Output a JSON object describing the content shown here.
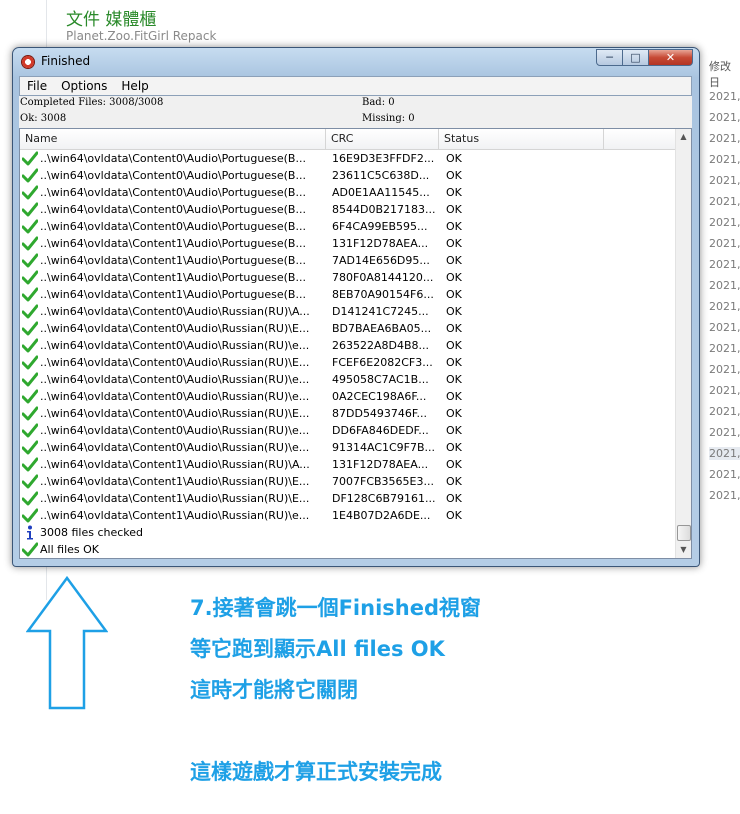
{
  "background": {
    "title": "文件 媒體櫃",
    "subtitle": "Planet.Zoo.FitGirl Repack",
    "column_header": "修改日",
    "dates": [
      "2021,",
      "2021,",
      "2021,",
      "2021,",
      "2021,",
      "2021,",
      "2021,",
      "2021,",
      "2021,",
      "2021,",
      "2021,",
      "2021,",
      "2021,",
      "2021,",
      "2021,",
      "2021,",
      "2021,",
      "2021,",
      "2021,",
      "2021,"
    ]
  },
  "window": {
    "title": "Finished",
    "buttons": {
      "minimize": "─",
      "maximize": "□",
      "close": "✕"
    },
    "menu": [
      "File",
      "Options",
      "Help"
    ],
    "status": {
      "completed": "Completed Files: 3008/3008",
      "bad": "Bad: 0",
      "ok": "Ok: 3008",
      "missing": "Missing: 0"
    },
    "columns": [
      "Name",
      "CRC",
      "Status"
    ],
    "rows": [
      {
        "name": "..\\win64\\ovldata\\Content0\\Audio\\Portuguese(B...",
        "crc": "16E9D3E3FFDF2...",
        "status": "OK"
      },
      {
        "name": "..\\win64\\ovldata\\Content0\\Audio\\Portuguese(B...",
        "crc": "23611C5C638D...",
        "status": "OK"
      },
      {
        "name": "..\\win64\\ovldata\\Content0\\Audio\\Portuguese(B...",
        "crc": "AD0E1AA11545...",
        "status": "OK"
      },
      {
        "name": "..\\win64\\ovldata\\Content0\\Audio\\Portuguese(B...",
        "crc": "8544D0B217183...",
        "status": "OK"
      },
      {
        "name": "..\\win64\\ovldata\\Content0\\Audio\\Portuguese(B...",
        "crc": "6F4CA99EB595...",
        "status": "OK"
      },
      {
        "name": "..\\win64\\ovldata\\Content1\\Audio\\Portuguese(B...",
        "crc": "131F12D78AEA...",
        "status": "OK"
      },
      {
        "name": "..\\win64\\ovldata\\Content1\\Audio\\Portuguese(B...",
        "crc": "7AD14E656D95...",
        "status": "OK"
      },
      {
        "name": "..\\win64\\ovldata\\Content1\\Audio\\Portuguese(B...",
        "crc": "780F0A8144120...",
        "status": "OK"
      },
      {
        "name": "..\\win64\\ovldata\\Content1\\Audio\\Portuguese(B...",
        "crc": "8EB70A90154F6...",
        "status": "OK"
      },
      {
        "name": "..\\win64\\ovldata\\Content0\\Audio\\Russian(RU)\\A...",
        "crc": "D141241C7245...",
        "status": "OK"
      },
      {
        "name": "..\\win64\\ovldata\\Content0\\Audio\\Russian(RU)\\E...",
        "crc": "BD7BAEA6BA05...",
        "status": "OK"
      },
      {
        "name": "..\\win64\\ovldata\\Content0\\Audio\\Russian(RU)\\e...",
        "crc": "263522A8D4B8...",
        "status": "OK"
      },
      {
        "name": "..\\win64\\ovldata\\Content0\\Audio\\Russian(RU)\\E...",
        "crc": "FCEF6E2082CF3...",
        "status": "OK"
      },
      {
        "name": "..\\win64\\ovldata\\Content0\\Audio\\Russian(RU)\\e...",
        "crc": "495058C7AC1B...",
        "status": "OK"
      },
      {
        "name": "..\\win64\\ovldata\\Content0\\Audio\\Russian(RU)\\e...",
        "crc": "0A2CEC198A6F...",
        "status": "OK"
      },
      {
        "name": "..\\win64\\ovldata\\Content0\\Audio\\Russian(RU)\\E...",
        "crc": "87DD5493746F...",
        "status": "OK"
      },
      {
        "name": "..\\win64\\ovldata\\Content0\\Audio\\Russian(RU)\\e...",
        "crc": "DD6FA846DEDF...",
        "status": "OK"
      },
      {
        "name": "..\\win64\\ovldata\\Content0\\Audio\\Russian(RU)\\e...",
        "crc": "91314AC1C9F7B...",
        "status": "OK"
      },
      {
        "name": "..\\win64\\ovldata\\Content1\\Audio\\Russian(RU)\\A...",
        "crc": "131F12D78AEA...",
        "status": "OK"
      },
      {
        "name": "..\\win64\\ovldata\\Content1\\Audio\\Russian(RU)\\E...",
        "crc": "7007FCB3565E3...",
        "status": "OK"
      },
      {
        "name": "..\\win64\\ovldata\\Content1\\Audio\\Russian(RU)\\E...",
        "crc": "DF128C6B79161...",
        "status": "OK"
      },
      {
        "name": "..\\win64\\ovldata\\Content1\\Audio\\Russian(RU)\\e...",
        "crc": "1E4B07D2A6DE...",
        "status": "OK"
      }
    ],
    "summary": [
      {
        "icon": "info-icon",
        "text": "3008 files checked"
      },
      {
        "icon": "check-icon",
        "text": "All files OK"
      }
    ],
    "colors": {
      "check": "#2fa82f",
      "info": "#1f3fbf"
    }
  },
  "annotation": {
    "lines": [
      "7.接著會跳一個Finished視窗",
      "等它跑到顯示All files OK",
      "這時才能將它關閉",
      "這樣遊戲才算正式安裝完成"
    ],
    "color": "#1ea0e6",
    "arrow_icon": "up-arrow-icon"
  }
}
